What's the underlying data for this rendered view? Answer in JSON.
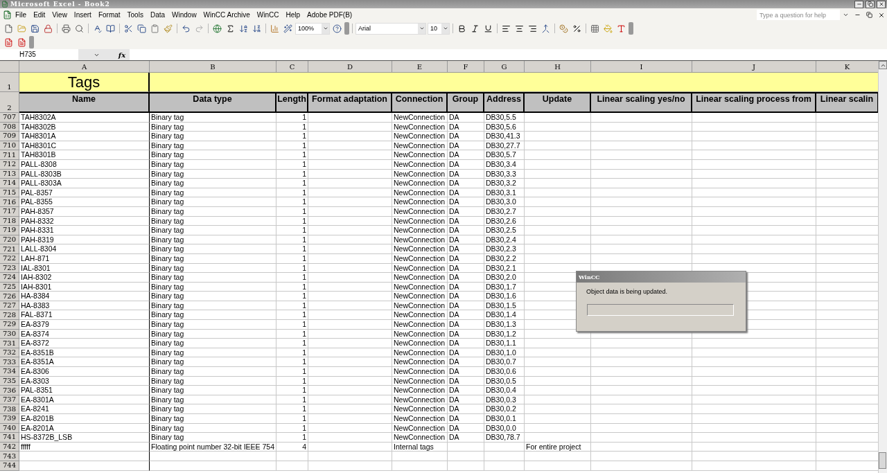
{
  "window": {
    "title": "Microsoft Excel - Book2"
  },
  "menu": [
    "File",
    "Edit",
    "View",
    "Insert",
    "Format",
    "Tools",
    "Data",
    "Window",
    "WinCC Archive",
    "WinCC",
    "Help",
    "Adobe PDF(B)"
  ],
  "help_box": {
    "placeholder": "Type a question for help"
  },
  "toolbar": {
    "zoom": "100%",
    "font": "Arial",
    "font_size": "10"
  },
  "formula_bar": {
    "name_box": "H735",
    "fx": "fx"
  },
  "columns": [
    "A",
    "B",
    "C",
    "D",
    "E",
    "F",
    "G",
    "H",
    "I",
    "J",
    "K"
  ],
  "title_row": {
    "row": "1",
    "title": "Tags"
  },
  "header_row": {
    "row": "2",
    "headers": [
      "Name",
      "Data type",
      "Length",
      "Format adaptation",
      "Connection",
      "Group",
      "Address",
      "Update",
      "Linear scaling yes/no",
      "Linear scaling process from",
      "Linear scalin"
    ]
  },
  "rows": [
    {
      "row": "707",
      "name": "TAH8302A",
      "data_type": "Binary tag",
      "length": "1",
      "connection": "NewConnection",
      "group": "DA",
      "address": "DB30,5.5"
    },
    {
      "row": "708",
      "name": "TAH8302B",
      "data_type": "Binary tag",
      "length": "1",
      "connection": "NewConnection",
      "group": "DA",
      "address": "DB30,5.6"
    },
    {
      "row": "709",
      "name": "TAH8301A",
      "data_type": "Binary tag",
      "length": "1",
      "connection": "NewConnection",
      "group": "DA",
      "address": "DB30,41.3"
    },
    {
      "row": "710",
      "name": "TAH8301C",
      "data_type": "Binary tag",
      "length": "1",
      "connection": "NewConnection",
      "group": "DA",
      "address": "DB30,27.7"
    },
    {
      "row": "711",
      "name": "TAH8301B",
      "data_type": "Binary tag",
      "length": "1",
      "connection": "NewConnection",
      "group": "DA",
      "address": "DB30,5.7"
    },
    {
      "row": "712",
      "name": "PALL-8308",
      "data_type": "Binary tag",
      "length": "1",
      "connection": "NewConnection",
      "group": "DA",
      "address": "DB30,3.4"
    },
    {
      "row": "713",
      "name": "PALL-8303B",
      "data_type": "Binary tag",
      "length": "1",
      "connection": "NewConnection",
      "group": "DA",
      "address": "DB30,3.3"
    },
    {
      "row": "714",
      "name": "PALL-8303A",
      "data_type": "Binary tag",
      "length": "1",
      "connection": "NewConnection",
      "group": "DA",
      "address": "DB30,3.2"
    },
    {
      "row": "715",
      "name": "PAL-8357",
      "data_type": "Binary tag",
      "length": "1",
      "connection": "NewConnection",
      "group": "DA",
      "address": "DB30,3.1"
    },
    {
      "row": "716",
      "name": "PAL-8355",
      "data_type": "Binary tag",
      "length": "1",
      "connection": "NewConnection",
      "group": "DA",
      "address": "DB30,3.0"
    },
    {
      "row": "717",
      "name": "PAH-8357",
      "data_type": "Binary tag",
      "length": "1",
      "connection": "NewConnection",
      "group": "DA",
      "address": "DB30,2.7"
    },
    {
      "row": "718",
      "name": "PAH-8332",
      "data_type": "Binary tag",
      "length": "1",
      "connection": "NewConnection",
      "group": "DA",
      "address": "DB30,2.6"
    },
    {
      "row": "719",
      "name": "PAH-8331",
      "data_type": "Binary tag",
      "length": "1",
      "connection": "NewConnection",
      "group": "DA",
      "address": "DB30,2.5"
    },
    {
      "row": "720",
      "name": "PAH-8319",
      "data_type": "Binary tag",
      "length": "1",
      "connection": "NewConnection",
      "group": "DA",
      "address": "DB30,2.4"
    },
    {
      "row": "721",
      "name": "LALL-8304",
      "data_type": "Binary tag",
      "length": "1",
      "connection": "NewConnection",
      "group": "DA",
      "address": "DB30,2.3"
    },
    {
      "row": "722",
      "name": "LAH-871",
      "data_type": "Binary tag",
      "length": "1",
      "connection": "NewConnection",
      "group": "DA",
      "address": "DB30,2.2"
    },
    {
      "row": "723",
      "name": "IAL-8301",
      "data_type": "Binary tag",
      "length": "1",
      "connection": "NewConnection",
      "group": "DA",
      "address": "DB30,2.1"
    },
    {
      "row": "724",
      "name": "IAH-8302",
      "data_type": "Binary tag",
      "length": "1",
      "connection": "NewConnection",
      "group": "DA",
      "address": "DB30,2.0"
    },
    {
      "row": "725",
      "name": "IAH-8301",
      "data_type": "Binary tag",
      "length": "1",
      "connection": "NewConnection",
      "group": "DA",
      "address": "DB30,1.7"
    },
    {
      "row": "726",
      "name": "HA-8384",
      "data_type": "Binary tag",
      "length": "1",
      "connection": "NewConnection",
      "group": "DA",
      "address": "DB30,1.6"
    },
    {
      "row": "727",
      "name": "HA-8383",
      "data_type": "Binary tag",
      "length": "1",
      "connection": "NewConnection",
      "group": "DA",
      "address": "DB30,1.5"
    },
    {
      "row": "728",
      "name": "FAL-8371",
      "data_type": "Binary tag",
      "length": "1",
      "connection": "NewConnection",
      "group": "DA",
      "address": "DB30,1.4"
    },
    {
      "row": "729",
      "name": "EA-8379",
      "data_type": "Binary tag",
      "length": "1",
      "connection": "NewConnection",
      "group": "DA",
      "address": "DB30,1.3"
    },
    {
      "row": "730",
      "name": "EA-8374",
      "data_type": "Binary tag",
      "length": "1",
      "connection": "NewConnection",
      "group": "DA",
      "address": "DB30,1.2"
    },
    {
      "row": "731",
      "name": "EA-8372",
      "data_type": "Binary tag",
      "length": "1",
      "connection": "NewConnection",
      "group": "DA",
      "address": "DB30,1.1"
    },
    {
      "row": "732",
      "name": "EA-8351B",
      "data_type": "Binary tag",
      "length": "1",
      "connection": "NewConnection",
      "group": "DA",
      "address": "DB30,1.0"
    },
    {
      "row": "733",
      "name": "EA-8351A",
      "data_type": "Binary tag",
      "length": "1",
      "connection": "NewConnection",
      "group": "DA",
      "address": "DB30,0.7"
    },
    {
      "row": "734",
      "name": "EA-8306",
      "data_type": "Binary tag",
      "length": "1",
      "connection": "NewConnection",
      "group": "DA",
      "address": "DB30,0.6"
    },
    {
      "row": "735",
      "name": "EA-8303",
      "data_type": "Binary tag",
      "length": "1",
      "connection": "NewConnection",
      "group": "DA",
      "address": "DB30,0.5"
    },
    {
      "row": "736",
      "name": "PAL-8351",
      "data_type": "Binary tag",
      "length": "1",
      "connection": "NewConnection",
      "group": "DA",
      "address": "DB30,0.4"
    },
    {
      "row": "737",
      "name": "EA-8301A",
      "data_type": "Binary tag",
      "length": "1",
      "connection": "NewConnection",
      "group": "DA",
      "address": "DB30,0.3"
    },
    {
      "row": "738",
      "name": "EA-8241",
      "data_type": "Binary tag",
      "length": "1",
      "connection": "NewConnection",
      "group": "DA",
      "address": "DB30,0.2"
    },
    {
      "row": "739",
      "name": "EA-8201B",
      "data_type": "Binary tag",
      "length": "1",
      "connection": "NewConnection",
      "group": "DA",
      "address": "DB30,0.1"
    },
    {
      "row": "740",
      "name": "EA-8201A",
      "data_type": "Binary tag",
      "length": "1",
      "connection": "NewConnection",
      "group": "DA",
      "address": "DB30,0.0"
    },
    {
      "row": "741",
      "name": "HS-8372B_LSB",
      "data_type": "Binary tag",
      "length": "1",
      "connection": "NewConnection",
      "group": "DA",
      "address": "DB30,78.7"
    },
    {
      "row": "742",
      "name": "fffff",
      "data_type": "Floating point number 32-bit IEEE 754",
      "length": "4",
      "connection": "Internal tags",
      "update": "For entire project"
    },
    {
      "row": "743"
    },
    {
      "row": "744"
    }
  ],
  "dialog": {
    "title": "WinCC",
    "message": "Object data is being updated.",
    "progress": {
      "level": 0
    }
  }
}
